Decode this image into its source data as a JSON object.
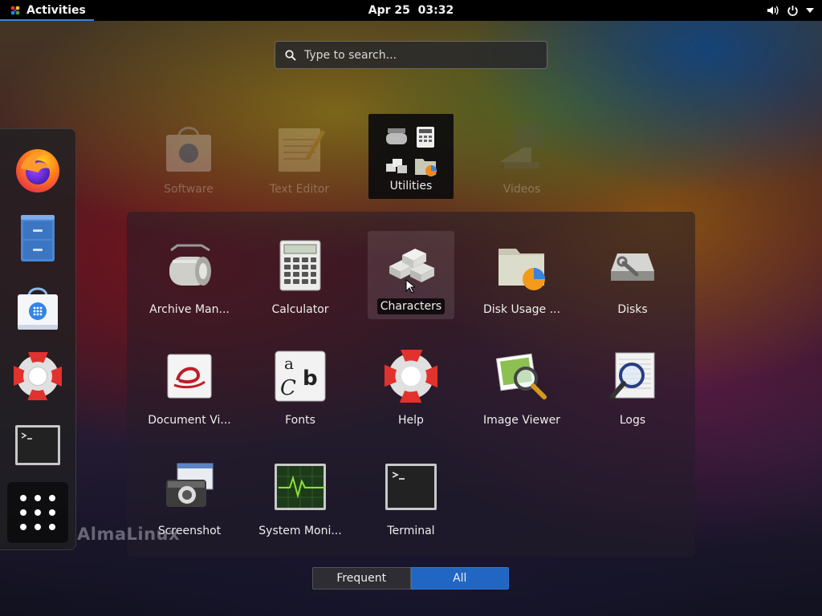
{
  "topbar": {
    "activities_label": "Activities",
    "clock": "Apr 25  03:32",
    "icons": [
      "volume-icon",
      "power-icon",
      "menu-arrow-icon"
    ]
  },
  "search": {
    "placeholder": "Type to search..."
  },
  "dash": {
    "items": [
      "firefox",
      "file-cabinet",
      "software",
      "help",
      "terminal",
      "show-applications"
    ]
  },
  "top_row": {
    "software": "Software",
    "text_editor": "Text Editor",
    "utilities": "Utilities",
    "videos": "Videos"
  },
  "folder_apps": [
    {
      "label": "Archive Man..."
    },
    {
      "label": "Calculator"
    },
    {
      "label": "Characters"
    },
    {
      "label": "Disk Usage ..."
    },
    {
      "label": "Disks"
    },
    {
      "label": "Document Vi..."
    },
    {
      "label": "Fonts"
    },
    {
      "label": "Help"
    },
    {
      "label": "Image Viewer"
    },
    {
      "label": "Logs"
    },
    {
      "label": "Screenshot"
    },
    {
      "label": "System Moni..."
    },
    {
      "label": "Terminal"
    }
  ],
  "fonts_icon_text": {
    "a": "a",
    "b": "b",
    "c": "C"
  },
  "watermark": "AlmaLinux",
  "switcher": {
    "frequent": "Frequent",
    "all": "All"
  },
  "colors": {
    "accent": "#3584e4",
    "selected_tab": "#2066c2"
  }
}
